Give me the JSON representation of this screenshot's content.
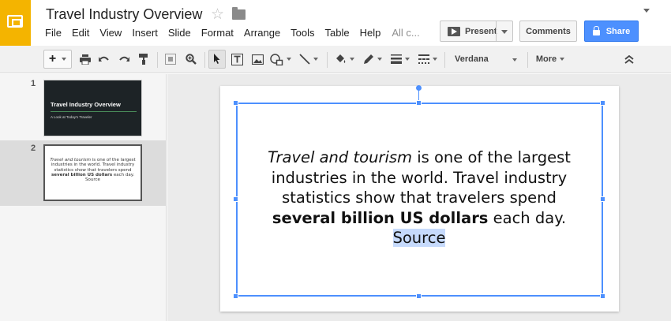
{
  "app": {
    "title": "Travel Industry Overview"
  },
  "menu": [
    "File",
    "Edit",
    "View",
    "Insert",
    "Slide",
    "Format",
    "Arrange",
    "Tools",
    "Table",
    "Help"
  ],
  "save_status": "All c...",
  "header": {
    "present_label": "Present",
    "comments_label": "Comments",
    "share_label": "Share"
  },
  "toolbar": {
    "font_name": "Verdana",
    "more_label": "More",
    "icons": [
      "new-slide",
      "print",
      "undo",
      "redo",
      "paint-format",
      "zoom-fit",
      "zoom",
      "select",
      "text-box",
      "image",
      "shape",
      "line",
      "fill-color",
      "line-color",
      "line-weight",
      "line-dash",
      "collapse-toolbar"
    ]
  },
  "filmstrip": {
    "slides": [
      {
        "number": "1",
        "title": "Travel Industry Overview",
        "subtitle": "A Look at Today's Traveler"
      },
      {
        "number": "2",
        "text": {
          "italic": "Travel and tourism",
          "part1": " is one of the largest industries in the world. Travel industry statistics show that travelers spend ",
          "bold": "several billion US dollars",
          "part2": " each day. Source"
        }
      }
    ]
  },
  "slide": {
    "italic": "Travel and tourism",
    "line1_rest": " is one of the largest",
    "line2": "industries in the world. Travel industry",
    "line3": "statistics show that travelers spend",
    "bold": "several billion US dollars",
    "line4_rest": " each day.",
    "link": "Source"
  },
  "colors": {
    "logo": "#f4b400",
    "share": "#4d90fe",
    "selection": "#4d90fe",
    "link_highlight": "#c6dafc",
    "thumb_dark": "#1d2326"
  }
}
